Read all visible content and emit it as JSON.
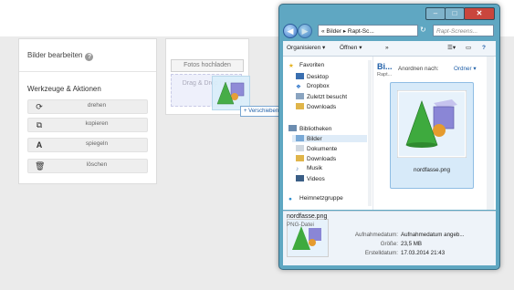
{
  "panel": {
    "title": "Bilder bearbeiten",
    "help_icon": "?",
    "section_title": "Werkzeuge & Aktionen",
    "tools": [
      {
        "icon": "rotate-icon",
        "glyph": "⟳",
        "label": "drehen"
      },
      {
        "icon": "copy-icon",
        "glyph": "⧉",
        "label": "kopieren"
      },
      {
        "icon": "mirror-icon",
        "glyph": "A",
        "label": "spiegeln"
      },
      {
        "icon": "trash-icon",
        "glyph": "🗑",
        "label": "löschen"
      }
    ]
  },
  "upload": {
    "button_label": "Fotos hochladen",
    "drop_text": "Drag & Drop hier"
  },
  "drag_tooltip": "+ Verschieben",
  "explorer": {
    "address": "« Bilder ▸ Rapt-Sc...",
    "search_placeholder": "Rapt-Screens...",
    "toolbar": {
      "organize": "Organisieren ▾",
      "open": "Öffnen ▾",
      "more": "»"
    },
    "nav": {
      "favorites": "Favoriten",
      "desktop": "Desktop",
      "dropbox": "Dropbox",
      "recent": "Zuletzt besucht",
      "downloads": "Downloads",
      "libraries": "Bibliotheken",
      "bilder": "Bilder",
      "documents": "Dokumente",
      "downloads2": "Downloads",
      "music": "Musik",
      "videos": "Videos",
      "homegroup": "Heimnetzgruppe"
    },
    "library_title": "Bi...",
    "library_sub": "Rapt...",
    "arrange_label": "Anordnen nach:",
    "arrange_value": "Ordner ▾",
    "file_name": "nordfasse.png",
    "details": {
      "name": "nordfasse.png",
      "type": "PNG-Datei",
      "date_label": "Aufnahmedatum:",
      "date_value": "Aufnahmedatum angeb...",
      "size_label": "Größe:",
      "size_value": "23,5 MB",
      "created_label": "Erstelldatum:",
      "created_value": "17.03.2014 21:43"
    }
  },
  "colors": {
    "accent": "#1f5fa8",
    "window_frame": "#5fa7c2",
    "close_button": "#c9463d"
  }
}
